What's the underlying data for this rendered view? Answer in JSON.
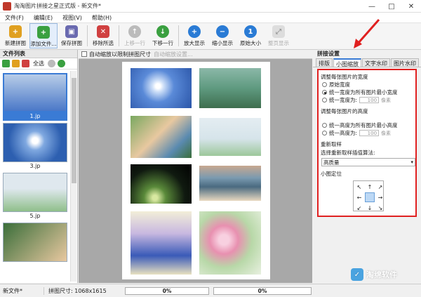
{
  "window": {
    "title": "淘淘图片拼接之星正式版 - 新文件*",
    "controls": [
      "—",
      "□",
      "✕"
    ]
  },
  "menu": [
    "文件(F)",
    "编辑(E)",
    "视图(V)",
    "帮助(H)"
  ],
  "toolbar": {
    "buttons": [
      {
        "label": "新建拼图",
        "icon": "folder-new-icon",
        "color": "#e0a020"
      },
      {
        "label": "添加文件...",
        "icon": "add-file-icon",
        "color": "#3aa040"
      },
      {
        "label": "保存拼图",
        "icon": "save-icon",
        "color": "#6a6ab0"
      },
      {
        "label": "移除所选",
        "icon": "remove-icon",
        "color": "#d04040"
      },
      {
        "label": "上移一行",
        "icon": "up-icon",
        "color": "#bbbbbb"
      },
      {
        "label": "下移一行",
        "icon": "down-icon",
        "color": "#3aa040"
      },
      {
        "label": "放大显示",
        "icon": "zoom-in-icon",
        "color": "#2a7bd5"
      },
      {
        "label": "缩小显示",
        "icon": "zoom-out-icon",
        "color": "#2a7bd5"
      },
      {
        "label": "原始大小",
        "icon": "actual-size-icon",
        "color": "#2a7bd5"
      },
      {
        "label": "整页显示",
        "icon": "fit-page-icon",
        "color": "#cccccc"
      }
    ]
  },
  "file_list": {
    "title": "文件列表",
    "select_all": "全选",
    "items": [
      {
        "caption": "1.jp",
        "selected": true,
        "colors": [
          "#4a78c8",
          "#b8cde8"
        ]
      },
      {
        "caption": "3.jp",
        "selected": false,
        "colors": [
          "#2d5fb0",
          "#7fa8e0"
        ]
      },
      {
        "caption": "5.jp",
        "selected": false,
        "colors": [
          "#dfe8ee",
          "#8fbf8a"
        ]
      },
      {
        "caption": "",
        "selected": false,
        "colors": [
          "#3a6e3a",
          "#e8c8a0"
        ]
      }
    ]
  },
  "canvas": {
    "auto_scale_label": "自动缩放以限制拼图尺寸",
    "auto_scale_settings": "自动缩放设置..."
  },
  "settings": {
    "title": "拼接设置",
    "tabs": [
      "排版",
      "小图缩放",
      "文字水印",
      "图片水印"
    ],
    "active_tab": 1,
    "width_section": "调整每张图片的宽度",
    "width_options": [
      "原始宽度",
      "统一宽度为所有图片最小宽度",
      "统一宽度为:"
    ],
    "width_value": "100",
    "height_section": "调整每张图片的高度",
    "height_options": [
      "统一高度为所有图片最小高度",
      "统一高度为:"
    ],
    "height_value": "100",
    "px_unit": "像素",
    "resample_title": "重新取样",
    "resample_label": "选择重新取样插值算法:",
    "resample_value": "高质量",
    "position_title": "小图定位",
    "position_arrows": [
      "↖",
      "↑",
      "↗",
      "←",
      "",
      "→",
      "↙",
      "↓",
      "↘"
    ]
  },
  "status": {
    "file": "新文件*",
    "size": "拼图尺寸: 1068x1615",
    "progress1": "0%",
    "progress2": "0%"
  },
  "watermark": "淘绵软件"
}
